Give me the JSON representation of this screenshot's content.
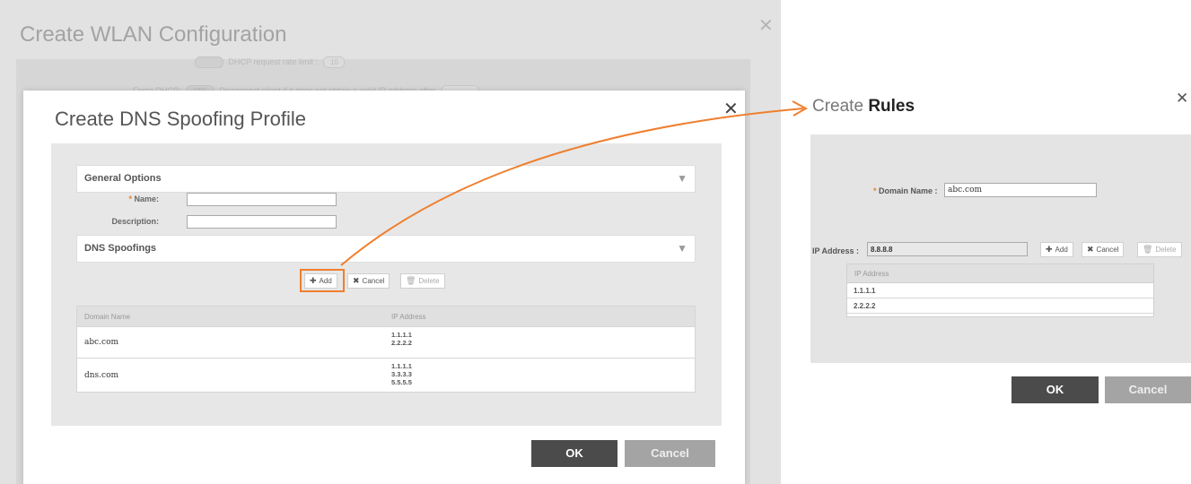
{
  "wlan": {
    "title": "Create WLAN Configuration",
    "faded_row1_text": "DHCP request rate limit :",
    "faded_row1_value": "10",
    "faded_row2_label": "Force DHCP:",
    "faded_row2_toggle": "OFF",
    "faded_row2_text": "Disconnect client if it does not obtain a valid IP address after"
  },
  "dns_profile": {
    "title": "Create DNS Spoofing Profile",
    "general_options": "General Options",
    "name_label": "Name:",
    "name_value": "",
    "description_label": "Description:",
    "description_value": "",
    "dns_spoofings": "DNS Spoofings",
    "toolbar": {
      "add": "Add",
      "cancel": "Cancel",
      "delete": "Delete"
    },
    "table": {
      "headers": [
        "Domain Name",
        "IP Address"
      ],
      "rows": [
        {
          "domain": "abc.com",
          "ips": [
            "1.1.1.1",
            "2.2.2.2"
          ]
        },
        {
          "domain": "dns.com",
          "ips": [
            "1.1.1.1",
            "3.3.3.3",
            "5.5.5.5"
          ]
        }
      ]
    },
    "ok": "OK",
    "cancel": "Cancel"
  },
  "rules": {
    "title_prefix": "Create",
    "title_bold": "Rules",
    "domain_name_label": "Domain Name :",
    "domain_name_value": "abc.com",
    "ip_address_label": "IP Address :",
    "ip_address_value": "8.8.8.8",
    "toolbar": {
      "add": "Add",
      "cancel": "Cancel",
      "delete": "Delete"
    },
    "table": {
      "header": "IP Address",
      "rows": [
        "1.1.1.1",
        "2.2.2.2"
      ]
    },
    "ok": "OK",
    "cancel": "Cancel"
  },
  "colors": {
    "highlight": "#ef7f2e",
    "ok_button": "#4b4b4b",
    "cancel_button": "#a4a4a4"
  },
  "icons": {
    "add": "plus-icon",
    "cancel": "x-icon",
    "delete": "trash-icon",
    "close": "close-icon",
    "collapse": "triangle-down-icon"
  }
}
